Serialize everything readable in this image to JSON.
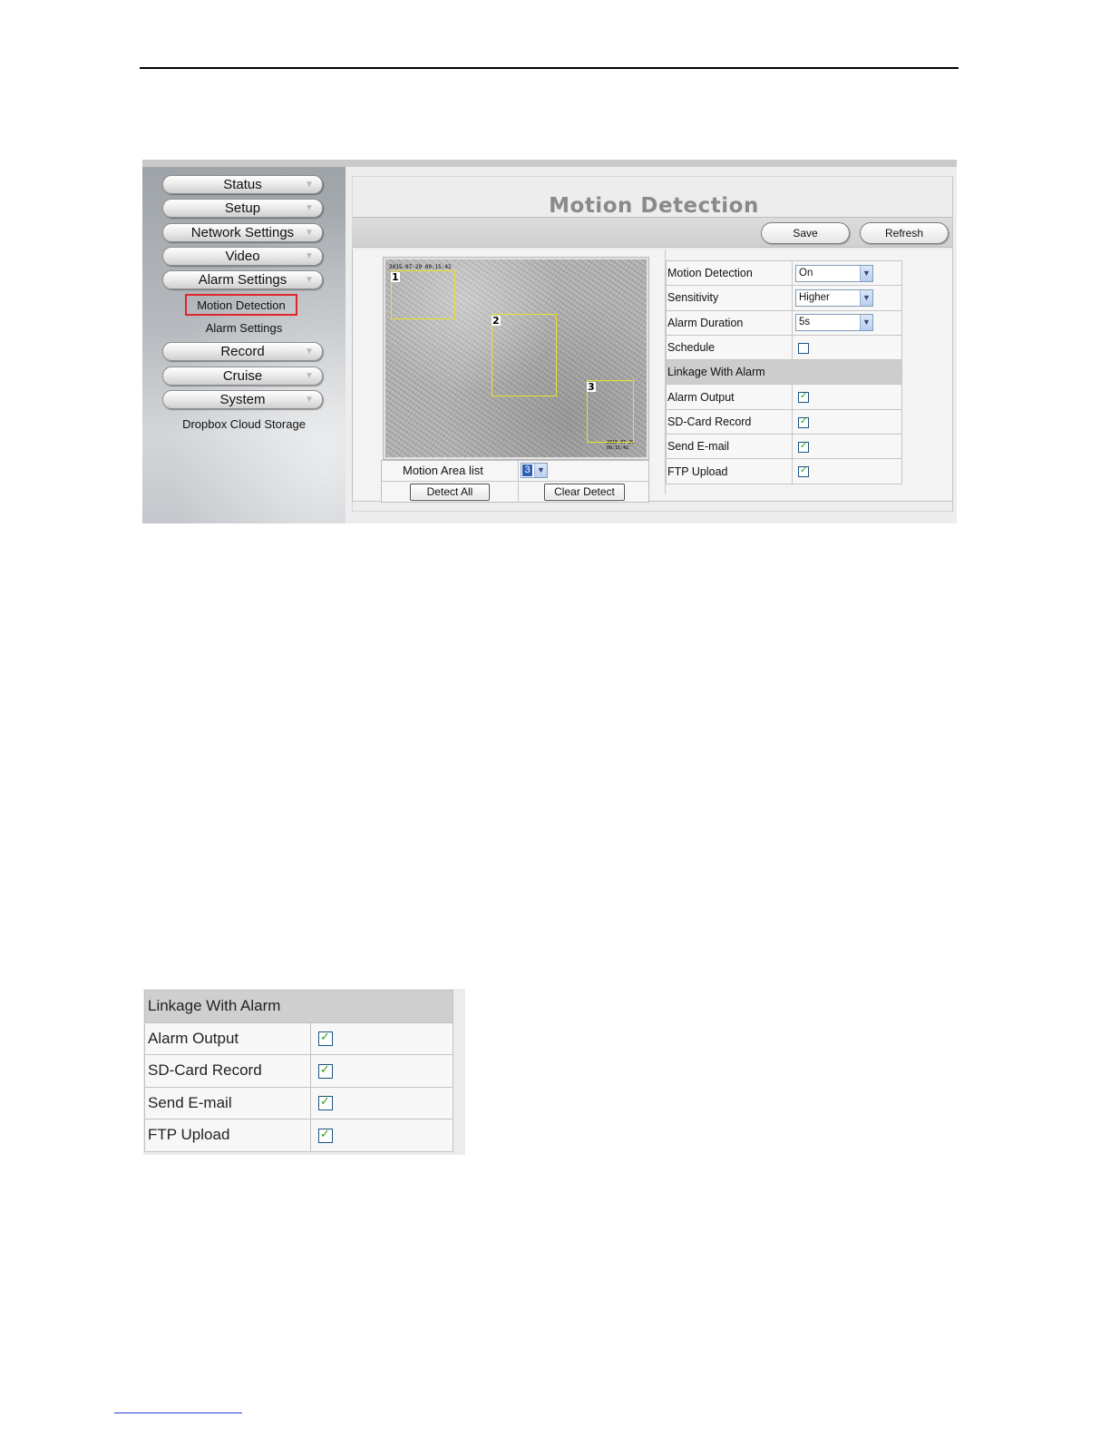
{
  "sidebar": {
    "menu": [
      {
        "label": "Status"
      },
      {
        "label": "Setup"
      },
      {
        "label": "Network Settings"
      },
      {
        "label": "Video"
      },
      {
        "label": "Alarm Settings"
      },
      {
        "label": "Record"
      },
      {
        "label": "Cruise"
      },
      {
        "label": "System"
      }
    ],
    "submenu": {
      "motion_detection": "Motion Detection",
      "alarm_settings": "Alarm Settings"
    },
    "dropbox": "Dropbox Cloud Storage"
  },
  "page": {
    "title": "Motion Detection",
    "save_label": "Save",
    "refresh_label": "Refresh"
  },
  "video": {
    "timestamp": "2015-07-29 09:15:42",
    "zones": [
      "1",
      "2",
      "3"
    ],
    "area_list_label": "Motion Area list",
    "area_list_value": "3",
    "detect_all_label": "Detect All",
    "clear_detect_label": "Clear Detect"
  },
  "settings": {
    "motion_detection_label": "Motion Detection",
    "motion_detection_value": "On",
    "sensitivity_label": "Sensitivity",
    "sensitivity_value": "Higher",
    "alarm_duration_label": "Alarm Duration",
    "alarm_duration_value": "5s",
    "schedule_label": "Schedule",
    "schedule_checked": false,
    "linkage_header": "Linkage With Alarm",
    "alarm_output_label": "Alarm Output",
    "sd_card_record_label": "SD-Card Record",
    "send_email_label": "Send E-mail",
    "ftp_upload_label": "FTP Upload",
    "alarm_output_checked": true,
    "sd_card_record_checked": true,
    "send_email_checked": true,
    "ftp_upload_checked": true
  },
  "zoom_panel": {
    "header": "Linkage With Alarm",
    "rows": [
      {
        "label": "Alarm Output",
        "checked": true
      },
      {
        "label": "SD-Card Record",
        "checked": true
      },
      {
        "label": "Send E-mail",
        "checked": true
      },
      {
        "label": "FTP Upload",
        "checked": true
      }
    ]
  },
  "colors": {
    "highlight_border": "#e0252b",
    "zone_border": "#e9e12a",
    "check_mark": "#21a121",
    "title_gray": "#8a8a8a"
  },
  "icons": {
    "menu_arrow": "chevron-down-icon",
    "select_arrow": "chevron-down-icon",
    "checkbox": "checkbox-icon"
  }
}
